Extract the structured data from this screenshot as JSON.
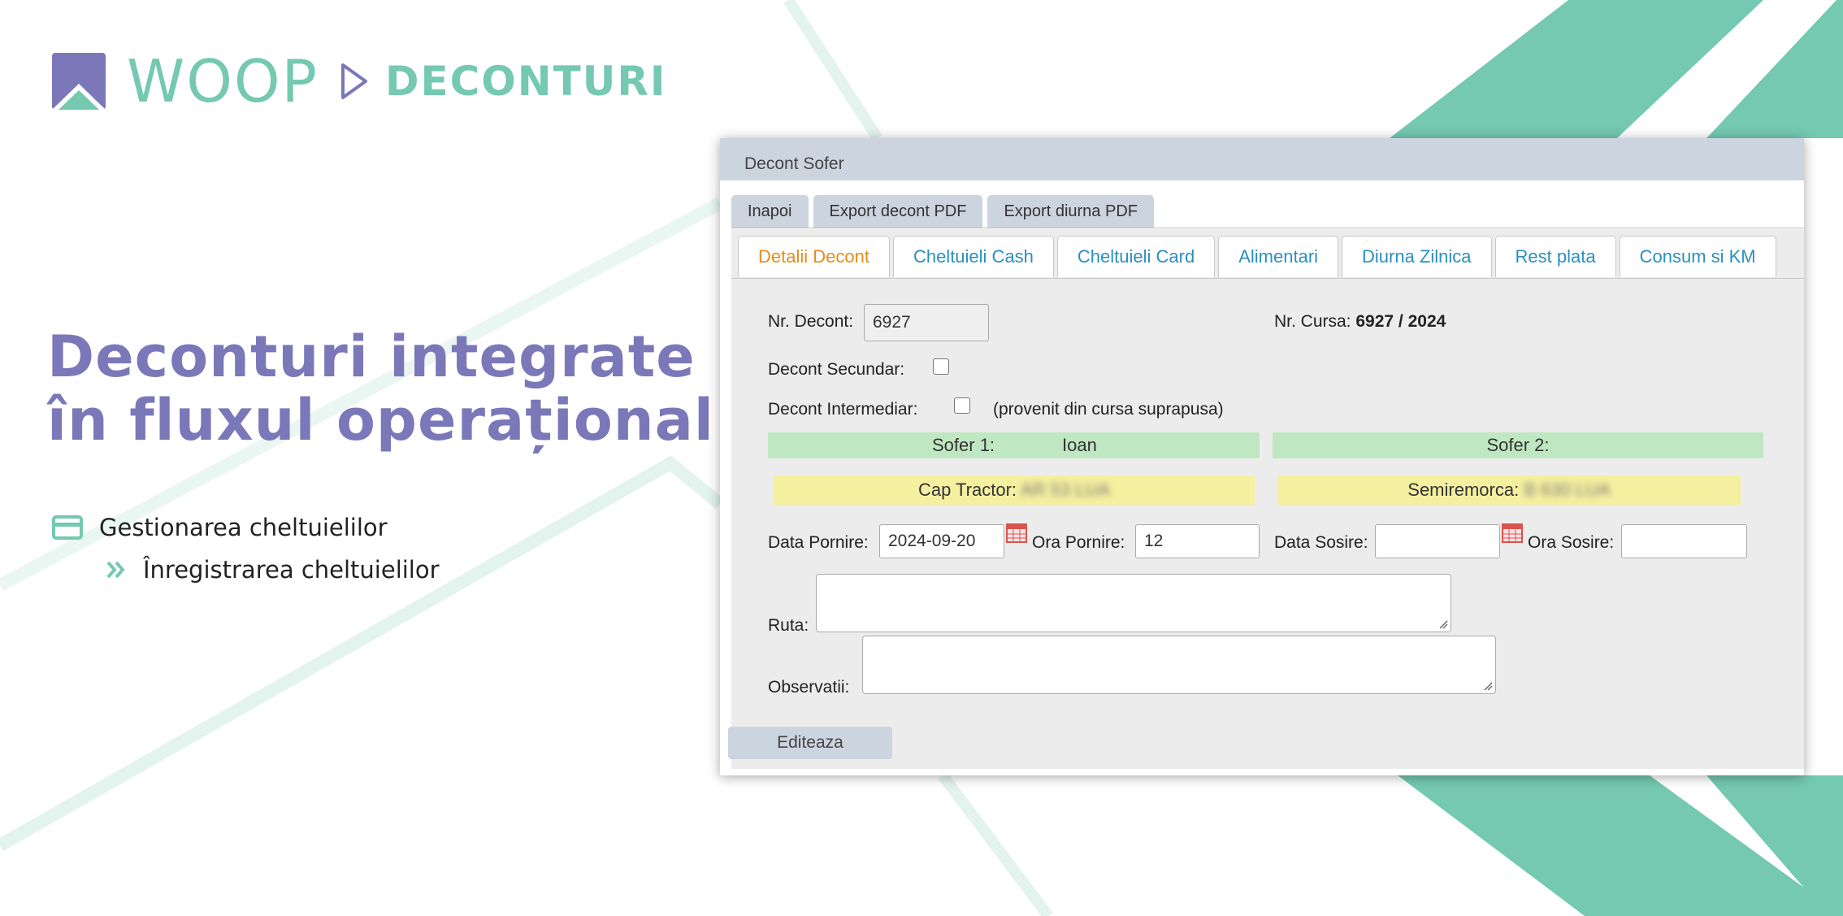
{
  "header": {
    "brand": "WOOP",
    "product": "DECONTURI"
  },
  "headline": {
    "line1": "Deconturi integrate",
    "line2": "în fluxul operațional"
  },
  "features": [
    {
      "label": "Gestionarea cheltuielilor",
      "icon": "card-icon"
    },
    {
      "label": "Înregistrarea cheltuielilor",
      "icon": "double-chevron-icon"
    }
  ],
  "colors": {
    "teal": "#74c9b0",
    "purple": "#7b78b9",
    "active_tab": "#e38e1a",
    "tab_text": "#2a8fbf"
  },
  "window": {
    "title": "Decont Sofer",
    "toolbar": [
      "Inapoi",
      "Export decont PDF",
      "Export diurna PDF"
    ],
    "tabs": [
      "Detalii Decont",
      "Cheltuieli Cash",
      "Cheltuieli Card",
      "Alimentari",
      "Diurna Zilnica",
      "Rest plata",
      "Consum si KM"
    ],
    "active_tab": "Detalii Decont",
    "form": {
      "nr_decont_label": "Nr. Decont:",
      "nr_decont_value": "6927",
      "nr_cursa_label": "Nr. Cursa:",
      "nr_cursa_value": "6927 / 2024",
      "decont_secundar_label": "Decont Secundar:",
      "decont_intermediar_label": "Decont Intermediar:",
      "decont_intermediar_note": "(provenit din cursa suprapusa)",
      "sofer1_label": "Sofer 1:",
      "sofer1_value": "Ioan",
      "sofer2_label": "Sofer 2:",
      "cap_tractor_label": "Cap Tractor:",
      "cap_tractor_value": "AR 53 LUA",
      "semiremorca_label": "Semiremorca:",
      "semiremorca_value": "B 630 LUA",
      "data_pornire_label": "Data Pornire:",
      "data_pornire_value": "2024-09-20",
      "ora_pornire_label": "Ora Pornire:",
      "ora_pornire_value": "12",
      "data_sosire_label": "Data Sosire:",
      "data_sosire_value": "",
      "ora_sosire_label": "Ora Sosire:",
      "ora_sosire_value": "",
      "ruta_label": "Ruta:",
      "observatii_label": "Observatii:"
    },
    "edit_button": "Editeaza"
  }
}
